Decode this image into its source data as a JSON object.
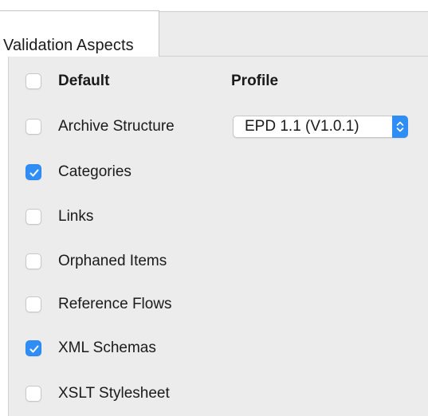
{
  "tab": {
    "label": "Validation Aspects"
  },
  "header": {
    "default_label": "Default",
    "profile_label": "Profile"
  },
  "profile_select": {
    "value": "EPD 1.1 (V1.0.1)"
  },
  "aspects": [
    {
      "label": "Archive Structure",
      "checked": false
    },
    {
      "label": "Categories",
      "checked": true
    },
    {
      "label": "Links",
      "checked": false
    },
    {
      "label": "Orphaned Items",
      "checked": false
    },
    {
      "label": "Reference Flows",
      "checked": false
    },
    {
      "label": "XML Schemas",
      "checked": true
    },
    {
      "label": "XSLT Stylesheet",
      "checked": false
    }
  ],
  "colors": {
    "accent": "#2f8ef6",
    "panel_bg": "#ececec",
    "text": "#1a1a1a"
  }
}
